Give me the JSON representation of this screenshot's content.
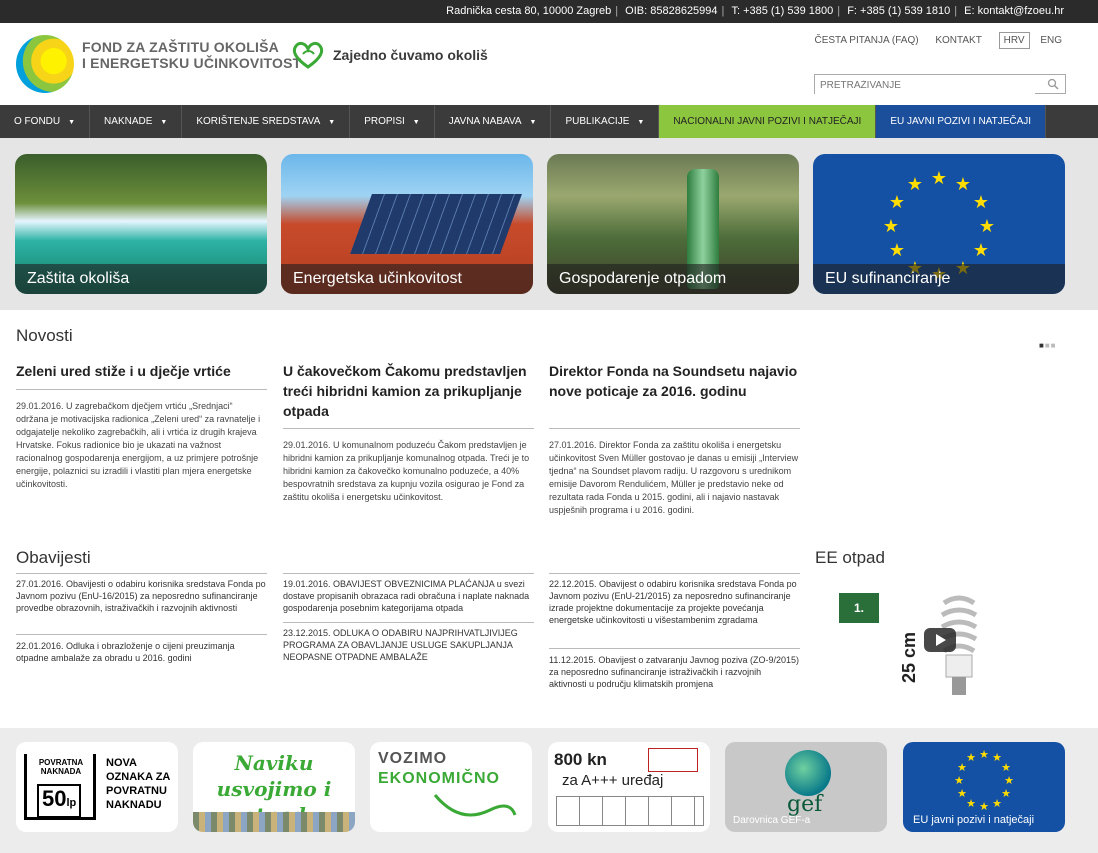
{
  "topbar": {
    "address": "Radnička cesta 80, 10000 Zagreb",
    "oib": "OIB: 85828625994",
    "tel": "T: +385 (1) 539 1800",
    "fax": "F: +385 (1) 539 1810",
    "email": "E: kontakt@fzoeu.hr"
  },
  "header": {
    "logo_line1": "FOND ZA ZAŠTITU OKOLIŠA",
    "logo_line2": "I ENERGETSKU UČINKOVITOST",
    "slogan": "Zajedno čuvamo okoliš",
    "faq": "ČESTA PITANJA (FAQ)",
    "contact": "KONTAKT",
    "lang_hr": "HRV",
    "lang_en": "ENG",
    "search_placeholder": "PRETRAŽIVANJE"
  },
  "nav": [
    {
      "label": "O FONDU"
    },
    {
      "label": "NAKNADE"
    },
    {
      "label": "KORIŠTENJE SREDSTAVA"
    },
    {
      "label": "PROPISI"
    },
    {
      "label": "JAVNA NABAVA"
    },
    {
      "label": "PUBLIKACIJE"
    },
    {
      "label": "NACIONALNI JAVNI POZIVI I NATJEČAJI"
    },
    {
      "label": "EU JAVNI POZIVI I NATJEČAJI"
    }
  ],
  "hero": [
    {
      "label": "Zaštita okoliša"
    },
    {
      "label": "Energetska učinkovitost"
    },
    {
      "label": "Gospodarenje otpadom"
    },
    {
      "label": "EU sufinanciranje"
    }
  ],
  "news": {
    "title": "Novosti",
    "items": [
      {
        "headline": "Zeleni ured stiže i u dječje vrtiće",
        "body": "29.01.2016. U zagrebačkom dječjem vrtiću „Srednjaci“ održana je motivacijska radionica „Zeleni ured“ za ravnatelje i odgajatelje nekoliko zagrebačkih, ali i vrtića iz drugih krajeva Hrvatske. Fokus radionice bio je ukazati na važnost racionalnog gospodarenja energijom, a uz primjere potrošnje energije, polaznici su izradili i vlastiti plan mjera energetske učinkovitosti."
      },
      {
        "headline": "U čakovečkom Čakomu predstavljen treći hibridni kamion za prikupljanje otpada",
        "body": "29.01.2016. U komunalnom poduzeću Čakom predstavljen je hibridni kamion za prikupljanje komunalnog otpada. Treći je to hibridni kamion za čakovečko komunalno poduzeće, a 40% bespovratnih sredstava za kupnju vozila osigurao je Fond za zaštitu okoliša i energetsku učinkovitost."
      },
      {
        "headline": "Direktor Fonda na Soundsetu najavio nove poticaje za 2016. godinu",
        "body": "27.01.2016. Direktor Fonda za zaštitu okoliša i energetsku učinkovitost Sven Müller gostovao je danas u emisiji „Interview tjedna“ na Soundset plavom radiju. U razgovoru s urednikom emisije Davorom Rendulićem, Müller je predstavio neke od rezultata rada Fonda u 2015. godini, ali i najavio nastavak uspješnih programa i u 2016. godini."
      }
    ]
  },
  "notices": {
    "title": "Obavijesti",
    "col1": [
      "27.01.2016. Obavijesti o odabiru korisnika sredstava Fonda po Javnom pozivu (EnU-16/2015) za neposredno sufinanciranje provedbe obrazovnih, istraživačkih i razvojnih aktivnosti",
      "22.01.2016. Odluka i obrazloženje o cijeni preuzimanja otpadne ambalaže za obradu u 2016. godini"
    ],
    "col2": [
      "19.01.2016. OBAVIJEST OBVEZNICIMA PLAĆANJA u svezi dostave propisanih obrazaca radi obračuna i naplate naknada gospodarenja posebnim kategorijama otpada",
      "23.12.2015. ODLUKA O ODABIRU NAJPRIHVATLJIVIJEG PROGRAMA ZA OBAVLJANJE USLUGE SAKUPLJANJA NEOPASNE OTPADNE AMBALAŽE"
    ],
    "col3": [
      "22.12.2015. Obavijest o odabiru korisnika sredstava Fonda po Javnom pozivu (EnU-21/2015) za neposredno sufinanciranje izrade projektne dokumentacije za projekte povećanja energetske učinkovitosti u višestambenim zgradama",
      "11.12.2015. Obavijest o zatvaranju Javnog poziva (ZO-9/2015) za neposredno sufinanciranje istraživačkih i razvojnih aktivnosti u području klimatskih promjena"
    ]
  },
  "ee": {
    "title": "EE otpad",
    "badge": "1.",
    "size": "25 cm"
  },
  "banners": {
    "b1_box_title": "POVRATNA NAKNADA",
    "b1_box_value": "50",
    "b1_box_unit": "lp",
    "b1_text": "NOVA OZNAKA ZA POVRATNU NAKNADU",
    "b2_text": "Naviku usvojimo i otpad odvojimo!",
    "b3_line1": "VOZIMO",
    "b3_line2": "EKONOMIČNO",
    "b4_line1": "800 kn",
    "b4_line2": "za A+++ uređaj",
    "b5_caption": "Darovnica GEF-a",
    "b6_caption": "EU javni pozivi i natječaji"
  }
}
